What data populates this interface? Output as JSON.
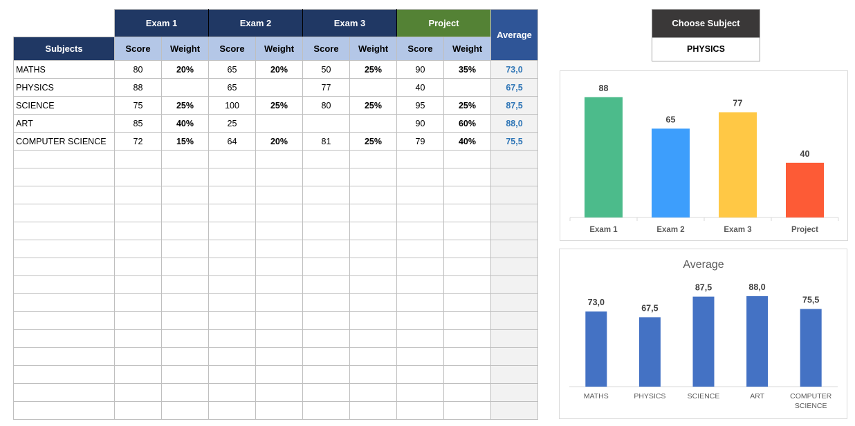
{
  "table": {
    "group_headers": [
      "Exam 1",
      "Exam 2",
      "Exam 3",
      "Project"
    ],
    "average_header": "Average",
    "subjects_header": "Subjects",
    "sub_headers": [
      "Score",
      "Weight",
      "Score",
      "Weight",
      "Score",
      "Weight",
      "Score",
      "Weight"
    ],
    "rows": [
      {
        "subject": "MATHS",
        "e1_score": "80",
        "e1_weight": "20%",
        "e2_score": "65",
        "e2_weight": "20%",
        "e3_score": "50",
        "e3_weight": "25%",
        "p_score": "90",
        "p_weight": "35%",
        "average": "73,0"
      },
      {
        "subject": "PHYSICS",
        "e1_score": "88",
        "e1_weight": "",
        "e2_score": "65",
        "e2_weight": "",
        "e3_score": "77",
        "e3_weight": "",
        "p_score": "40",
        "p_weight": "",
        "average": "67,5"
      },
      {
        "subject": "SCIENCE",
        "e1_score": "75",
        "e1_weight": "25%",
        "e2_score": "100",
        "e2_weight": "25%",
        "e3_score": "80",
        "e3_weight": "25%",
        "p_score": "95",
        "p_weight": "25%",
        "average": "87,5"
      },
      {
        "subject": "ART",
        "e1_score": "85",
        "e1_weight": "40%",
        "e2_score": "25",
        "e2_weight": "",
        "e3_score": "",
        "e3_weight": "",
        "p_score": "90",
        "p_weight": "60%",
        "average": "88,0"
      },
      {
        "subject": "COMPUTER SCIENCE",
        "e1_score": "72",
        "e1_weight": "15%",
        "e2_score": "64",
        "e2_weight": "20%",
        "e3_score": "81",
        "e3_weight": "25%",
        "p_score": "79",
        "p_weight": "40%",
        "average": "75,5"
      }
    ],
    "empty_row_count": 15
  },
  "chooser": {
    "label": "Choose Subject",
    "selected": "PHYSICS"
  },
  "colors": {
    "exam_header": "#203864",
    "project_header": "#548235",
    "average_header": "#2f5597",
    "sub_header": "#b4c7e7",
    "average_text": "#2e75b6",
    "chooser_header": "#3a3838"
  },
  "chart_data": [
    {
      "type": "bar",
      "title": "",
      "categories": [
        "Exam 1",
        "Exam 2",
        "Exam 3",
        "Project"
      ],
      "values": [
        88,
        65,
        77,
        40
      ],
      "data_labels": [
        "88",
        "65",
        "77",
        "40"
      ],
      "bar_colors": [
        "#4cbb8b",
        "#3d9efc",
        "#ffc845",
        "#fd5b36"
      ],
      "xlabel": "",
      "ylabel": "",
      "ylim": [
        0,
        100
      ],
      "grid": false,
      "legend": "none"
    },
    {
      "type": "bar",
      "title": "Average",
      "categories": [
        "MATHS",
        "PHYSICS",
        "SCIENCE",
        "ART",
        "COMPUTER SCIENCE"
      ],
      "values": [
        73.0,
        67.5,
        87.5,
        88.0,
        75.5
      ],
      "data_labels": [
        "73,0",
        "67,5",
        "87,5",
        "88,0",
        "75,5"
      ],
      "bar_colors": [
        "#4472c4"
      ],
      "xlabel": "",
      "ylabel": "",
      "ylim": [
        0,
        100
      ],
      "grid": false,
      "legend": "none"
    }
  ]
}
